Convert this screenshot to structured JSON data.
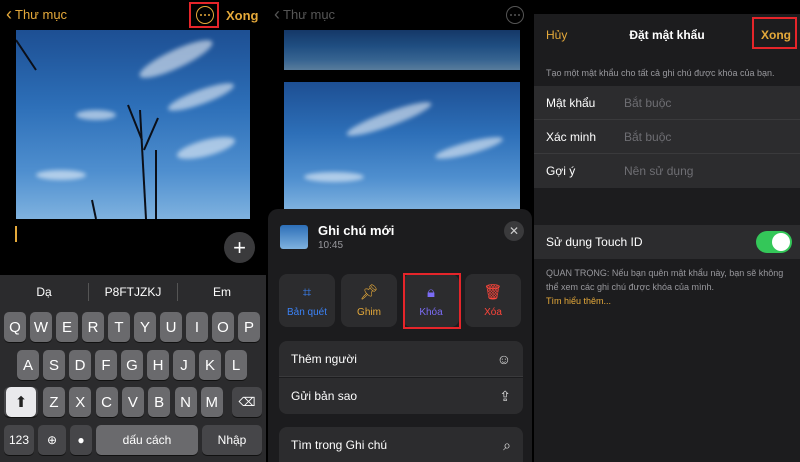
{
  "colors": {
    "accent": "#e5a93a",
    "highlight": "#e5252a",
    "toggle_on": "#34c759"
  },
  "panel1": {
    "nav": {
      "back_label": "Thư mục",
      "done_label": "Xong",
      "more_icon": "ellipsis-circle-icon"
    },
    "suggestions": [
      "Dạ",
      "P8FTJZKJ",
      "Em"
    ],
    "keys_row1": [
      "Q",
      "W",
      "E",
      "R",
      "T",
      "Y",
      "U",
      "I",
      "O",
      "P"
    ],
    "keys_row2": [
      "A",
      "S",
      "D",
      "F",
      "G",
      "H",
      "J",
      "K",
      "L"
    ],
    "keys_row3": [
      "Z",
      "X",
      "C",
      "V",
      "B",
      "N",
      "M"
    ],
    "key_123": "123",
    "space_label": "dấu cách",
    "return_label": "Nhập"
  },
  "panel2": {
    "nav": {
      "back_label": "Thư mục"
    },
    "sheet": {
      "title": "Ghi chú mới",
      "time": "10:45",
      "actions": [
        {
          "label": "Bản quét",
          "icon": "scan-icon",
          "color": "#3b82f6"
        },
        {
          "label": "Ghim",
          "icon": "pin-icon",
          "color": "#e5a93a"
        },
        {
          "label": "Khóa",
          "icon": "lock-icon",
          "color": "#7b6cf6"
        },
        {
          "label": "Xóa",
          "icon": "trash-icon",
          "color": "#ff453a"
        }
      ],
      "rows": [
        {
          "label": "Thêm người",
          "icon": "add-person-icon"
        },
        {
          "label": "Gửi bản sao",
          "icon": "share-icon"
        },
        {
          "label": "Tìm trong Ghi chú",
          "icon": "search-icon"
        }
      ]
    }
  },
  "panel3": {
    "cancel_label": "Hủy",
    "title": "Đặt mật khẩu",
    "done_label": "Xong",
    "intro": "Tạo một mật khẩu cho tất cả ghi chú được khóa của bạn.",
    "fields": [
      {
        "label": "Mật khẩu",
        "placeholder": "Bắt buộc"
      },
      {
        "label": "Xác minh",
        "placeholder": "Bắt buộc"
      },
      {
        "label": "Gợi ý",
        "placeholder": "Nên sử dụng"
      }
    ],
    "touch_id_label": "Sử dụng Touch ID",
    "touch_id_on": true,
    "warning": "QUAN TRỌNG: Nếu bạn quên mật khẩu này, bạn sẽ không thể xem các ghi chú được khóa của mình.",
    "learn_more": "Tìm hiểu thêm..."
  }
}
